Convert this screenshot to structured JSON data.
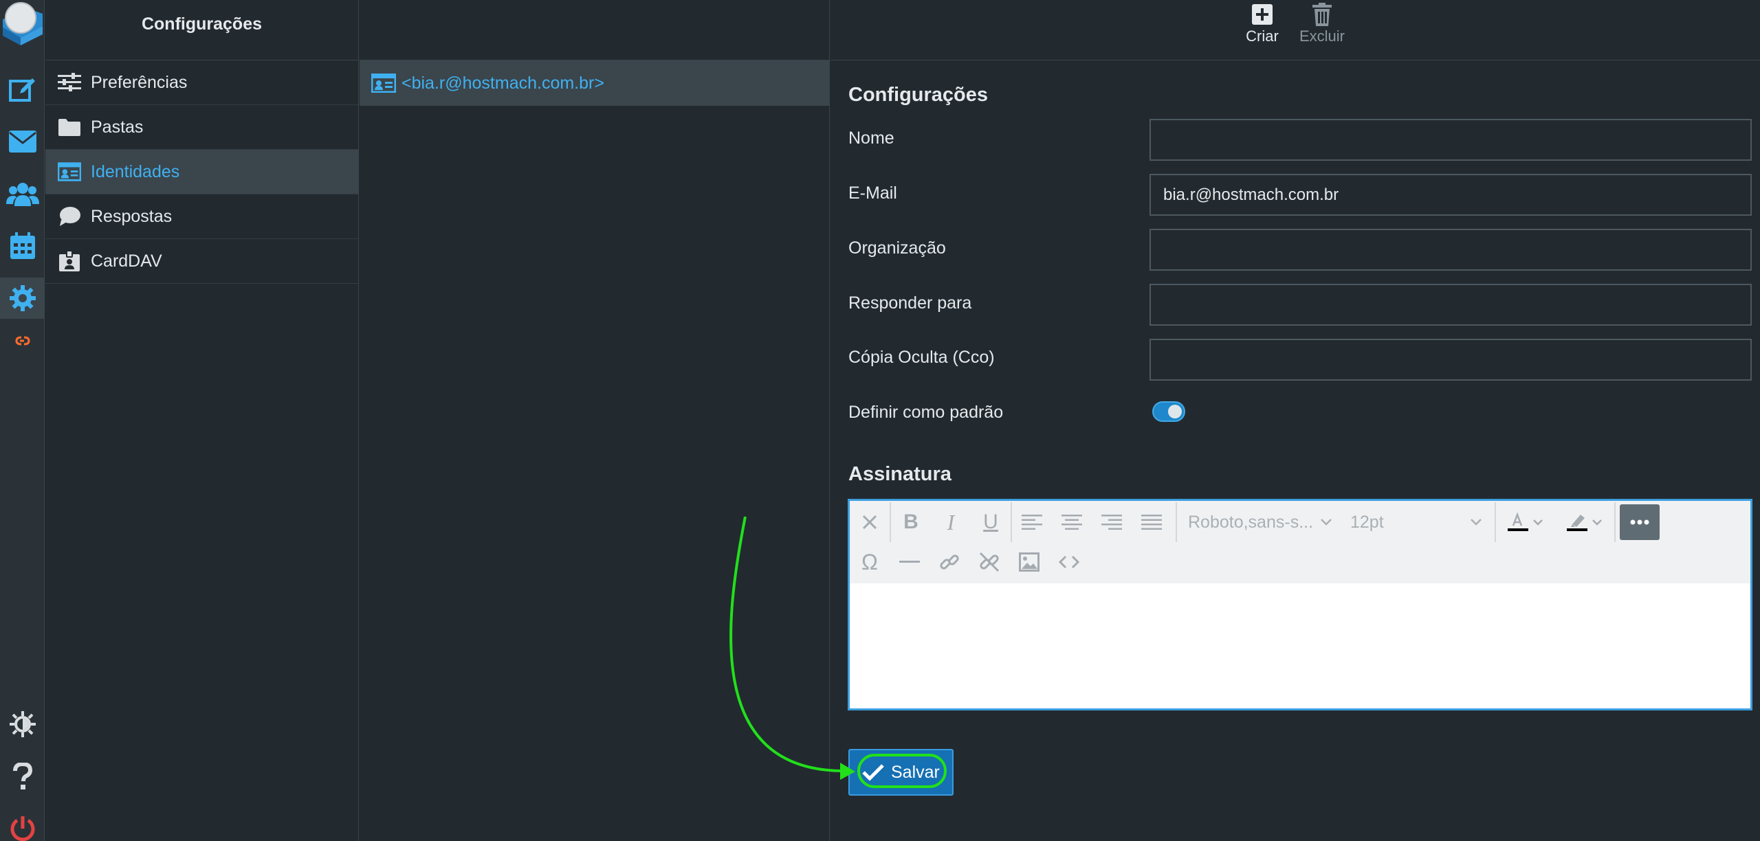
{
  "sidebar": {
    "title": "Configurações",
    "items": [
      {
        "label": "Preferências",
        "icon": "sliders-icon"
      },
      {
        "label": "Pastas",
        "icon": "folder-icon"
      },
      {
        "label": "Identidades",
        "icon": "id-card-icon"
      },
      {
        "label": "Respostas",
        "icon": "speech-bubble-icon"
      },
      {
        "label": "CardDAV",
        "icon": "badge-icon"
      }
    ]
  },
  "identities": {
    "items": [
      {
        "label": "<bia.r@hostmach.com.br>"
      }
    ]
  },
  "toolbar": {
    "create_label": "Criar",
    "delete_label": "Excluir"
  },
  "form": {
    "section_title": "Configurações",
    "name_label": "Nome",
    "name_value": "",
    "email_label": "E-Mail",
    "email_value": "bia.r@hostmach.com.br",
    "organization_label": "Organização",
    "organization_value": "",
    "reply_to_label": "Responder para",
    "reply_to_value": "",
    "bcc_label": "Cópia Oculta (Cco)",
    "bcc_value": "",
    "default_label": "Definir como padrão",
    "default_enabled": true
  },
  "signature": {
    "title": "Assinatura",
    "font_family": "Roboto,sans-s...",
    "font_size": "12pt"
  },
  "save_label": "Salvar",
  "colors": {
    "accent": "#3fb1f0",
    "background": "#222a30",
    "annotation": "#22e01a",
    "save_button": "#1670b4"
  }
}
